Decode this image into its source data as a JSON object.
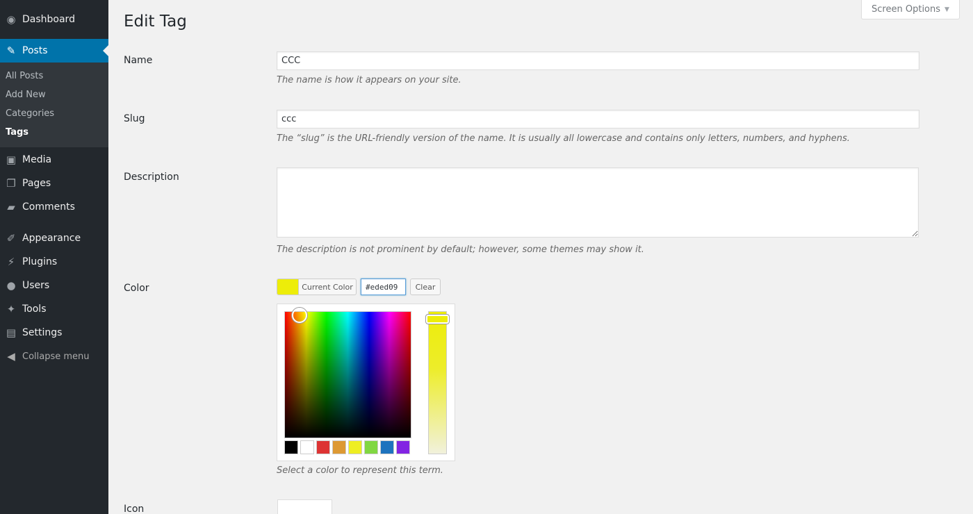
{
  "sidebar": {
    "items": [
      {
        "label": "Dashboard",
        "icon": "dashboard-icon"
      },
      {
        "label": "Posts",
        "icon": "pushpin-icon"
      },
      {
        "label": "Media",
        "icon": "media-icon"
      },
      {
        "label": "Pages",
        "icon": "pages-icon"
      },
      {
        "label": "Comments",
        "icon": "comments-icon"
      },
      {
        "label": "Appearance",
        "icon": "paintbrush-icon"
      },
      {
        "label": "Plugins",
        "icon": "plugin-icon"
      },
      {
        "label": "Users",
        "icon": "user-icon"
      },
      {
        "label": "Tools",
        "icon": "wrench-icon"
      },
      {
        "label": "Settings",
        "icon": "settings-icon"
      }
    ],
    "submenu": [
      "All Posts",
      "Add New",
      "Categories",
      "Tags"
    ],
    "collapse_label": "Collapse menu"
  },
  "screen_options": "Screen Options",
  "page_title": "Edit Tag",
  "form": {
    "name": {
      "label": "Name",
      "value": "CCC",
      "help": "The name is how it appears on your site."
    },
    "slug": {
      "label": "Slug",
      "value": "ccc",
      "help": "The “slug” is the URL-friendly version of the name. It is usually all lowercase and contains only letters, numbers, and hyphens."
    },
    "description": {
      "label": "Description",
      "value": "",
      "help": "The description is not prominent by default; however, some themes may show it."
    },
    "color": {
      "label": "Color",
      "current_color_label": "Current Color",
      "hex_value": "#eded09",
      "clear_label": "Clear",
      "help": "Select a color to represent this term.",
      "palette": [
        "#000000",
        "#ffffff",
        "#dd3333",
        "#dd9933",
        "#eeee22",
        "#81d742",
        "#1e73be",
        "#8224e3"
      ]
    },
    "icon": {
      "label": "Icon"
    }
  },
  "colors": {
    "sidebar_bg": "#23282d",
    "accent": "#0073aa",
    "selected_color": "#eded09"
  }
}
